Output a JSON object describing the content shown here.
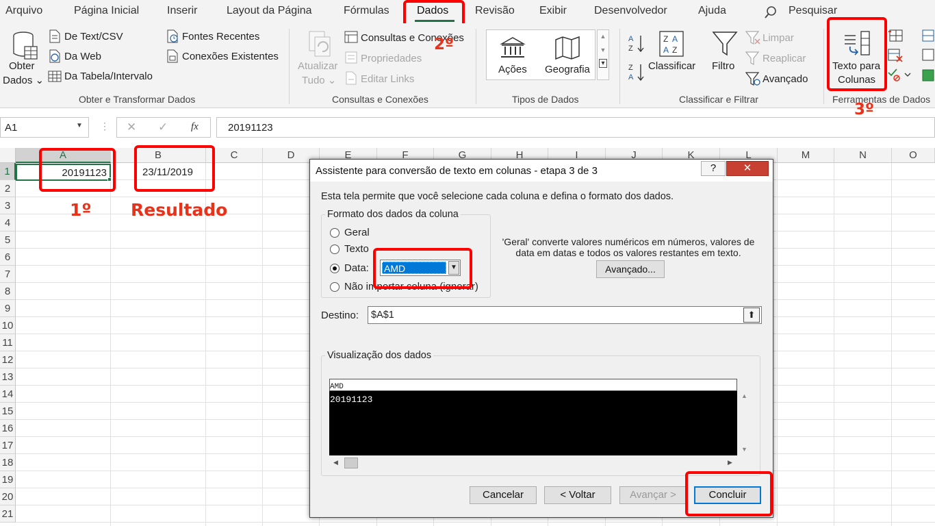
{
  "tabs": [
    "Arquivo",
    "Página Inicial",
    "Inserir",
    "Layout da Página",
    "Fórmulas",
    "Dados",
    "Revisão",
    "Exibir",
    "Desenvolvedor",
    "Ajuda"
  ],
  "search_label": "Pesquisar",
  "ribbon": {
    "obter_dados": [
      "Obter",
      "Dados ⌄"
    ],
    "from_text": "De Text/CSV",
    "from_web": "Da Web",
    "from_table": "Da Tabela/Intervalo",
    "recent_sources": "Fontes Recentes",
    "existing_connections": "Conexões Existentes",
    "group_get": "Obter e Transformar Dados",
    "refresh_all": [
      "Atualizar",
      "Tudo ⌄"
    ],
    "queries": "Consultas e Conexões",
    "properties": "Propriedades",
    "edit_links": "Editar Links",
    "group_queries": "Consultas e Conexões",
    "stocks": "Ações",
    "geography": "Geografia",
    "group_types": "Tipos de Dados",
    "sort": "Classificar",
    "filter": "Filtro",
    "clear": "Limpar",
    "reapply": "Reaplicar",
    "advanced": "Avançado",
    "group_sort": "Classificar e Filtrar",
    "text_to_columns": [
      "Texto para",
      "Colunas"
    ],
    "group_tools": "Ferramentas de Dados"
  },
  "formula_bar": {
    "name_box": "A1",
    "fx": "fx",
    "value": "20191123"
  },
  "columns": [
    "A",
    "B",
    "C",
    "D",
    "E",
    "F",
    "G",
    "H",
    "I",
    "J",
    "K",
    "L",
    "M",
    "N",
    "O"
  ],
  "rows": [
    "1",
    "2",
    "3",
    "4",
    "5",
    "6",
    "7",
    "8",
    "9",
    "10",
    "11",
    "12",
    "13",
    "14",
    "15",
    "16",
    "17",
    "18",
    "19",
    "20",
    "21"
  ],
  "cells": {
    "A1": "20191123",
    "B1": "23/11/2019"
  },
  "annotations": {
    "step1": "1º",
    "step2": "2º",
    "step3": "3º",
    "result": "Resultado"
  },
  "dialog": {
    "title": "Assistente para conversão de texto em colunas - etapa 3 de 3",
    "help_btn": "?",
    "close_btn": "✕",
    "intro": "Esta tela permite que você selecione cada coluna e defina o formato dos dados.",
    "format_group": "Formato dos dados da coluna",
    "opt_general": "Geral",
    "opt_text": "Texto",
    "opt_date": "Data:",
    "opt_skip": "Não importar coluna (ignorar)",
    "date_format": "AMD",
    "general_note": "'Geral' converte valores numéricos em números, valores de data em datas e todos os valores restantes em texto.",
    "advanced_btn": "Avançado...",
    "destination_label": "Destino:",
    "destination_value": "$A$1",
    "preview_label": "Visualização dos dados",
    "preview_header": "AMD",
    "preview_row": "20191123",
    "cancel": "Cancelar",
    "back": "< Voltar",
    "next": "Avançar >",
    "finish": "Concluir"
  },
  "colors": {
    "accent": "#217346",
    "annotation": "#ff0000"
  }
}
